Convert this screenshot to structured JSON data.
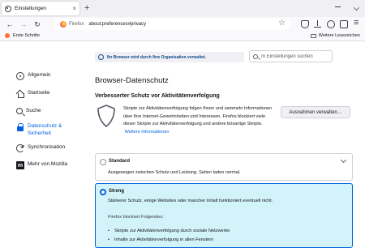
{
  "tab": {
    "title": "Einstellungen",
    "close": "×",
    "new_tab": "+"
  },
  "urlbar": {
    "identity": "Firefox",
    "url": "about:preferences#privacy",
    "star": "☆"
  },
  "nav": {
    "back": "←",
    "forward": "→",
    "reload": "↻"
  },
  "bookmarks": {
    "first": "Erste Schritte",
    "other": "Weitere Lesezeichen"
  },
  "policy": {
    "text": "Ihr Browser wird durch Ihre Organisation verwaltet."
  },
  "search": {
    "placeholder": "In Einstellungen suchen"
  },
  "sidebar": {
    "items": [
      {
        "label": "Allgemein",
        "icon": "gear-icon"
      },
      {
        "label": "Startseite",
        "icon": "home-icon"
      },
      {
        "label": "Suche",
        "icon": "search-icon"
      },
      {
        "label": "Datenschutz & Sicherheit",
        "icon": "lock-icon"
      },
      {
        "label": "Synchronisation",
        "icon": "sync-icon"
      },
      {
        "label": "Mehr von Mozilla",
        "icon": "mozilla-icon"
      }
    ],
    "selected_index": 3
  },
  "main": {
    "title": "Browser-Datenschutz",
    "etp_heading": "Verbesserter Schutz vor Aktivitätenverfolgung",
    "etp_desc": "Skripte zur Aktivitätenverfolgung folgen Ihnen und sammeln Informationen über Ihre Internet-Gewohnheiten und Interessen. Firefox blockiert viele dieser Skripte zur Aktivitätenverfolgung und andere bösartige Skripte.",
    "etp_more": "Weitere Informationen",
    "exceptions_button": "Ausnahmen verwalten…",
    "standard": {
      "label": "Standard",
      "desc": "Ausgewogen zwischen Schutz und Leistung. Seiten laden normal."
    },
    "strict": {
      "label": "Streng",
      "desc": "Stärkerer Schutz, einige Websites oder mancher Inhalt funktioniert eventuell nicht.",
      "blocks_heading": "Firefox blockiert Folgendes:",
      "bullets": [
        "Skripte zur Aktivitätenverfolgung durch soziale Netzwerke",
        "Inhalte zur Aktivitätenverfolgung in allen Fenstern"
      ]
    },
    "selected_option": "strict"
  },
  "colors": {
    "accent": "#0060df",
    "strict_bg": "#d1f3f9",
    "toolbar": "#f9f9fb",
    "tabstrip": "#f0f0f4"
  }
}
